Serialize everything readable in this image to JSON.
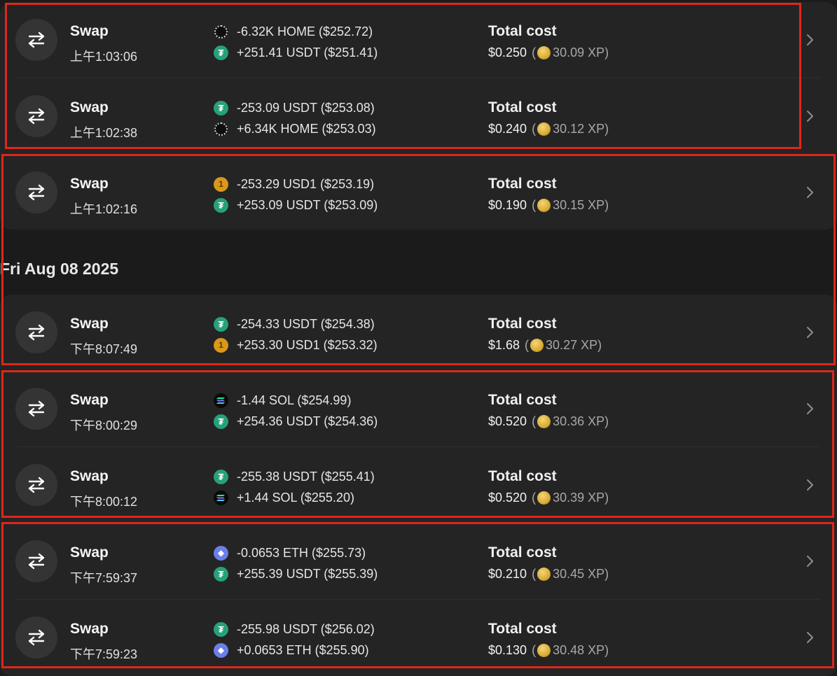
{
  "date_header": "Fri Aug 08 2025",
  "colors": {
    "background": "#1b1b1b",
    "card": "#242424",
    "highlight_box": "#e0261b",
    "usdt": "#26a17b",
    "usd1": "#d9981a",
    "eth": "#6c7fe8"
  },
  "cost_label": "Total cost",
  "transactions": [
    {
      "type": "Swap",
      "time": "上午1:03:06",
      "sent": {
        "token": "HOME",
        "icon": "home-token-icon",
        "text": "-6.32K HOME ($252.72)"
      },
      "received": {
        "token": "USDT",
        "icon": "usdt-token-icon",
        "text": "+251.41 USDT ($251.41)"
      },
      "cost": "$0.250",
      "xp": "30.09 XP"
    },
    {
      "type": "Swap",
      "time": "上午1:02:38",
      "sent": {
        "token": "USDT",
        "icon": "usdt-token-icon",
        "text": "-253.09 USDT ($253.08)"
      },
      "received": {
        "token": "HOME",
        "icon": "home-token-icon",
        "text": "+6.34K HOME ($253.03)"
      },
      "cost": "$0.240",
      "xp": "30.12 XP"
    },
    {
      "type": "Swap",
      "time": "上午1:02:16",
      "sent": {
        "token": "USD1",
        "icon": "usd1-token-icon",
        "text": "-253.29 USD1 ($253.19)"
      },
      "received": {
        "token": "USDT",
        "icon": "usdt-token-icon",
        "text": "+253.09 USDT ($253.09)"
      },
      "cost": "$0.190",
      "xp": "30.15 XP"
    },
    {
      "type": "Swap",
      "time": "下午8:07:49",
      "sent": {
        "token": "USDT",
        "icon": "usdt-token-icon",
        "text": "-254.33 USDT ($254.38)"
      },
      "received": {
        "token": "USD1",
        "icon": "usd1-token-icon",
        "text": "+253.30 USD1 ($253.32)"
      },
      "cost": "$1.68",
      "xp": "30.27 XP"
    },
    {
      "type": "Swap",
      "time": "下午8:00:29",
      "sent": {
        "token": "SOL",
        "icon": "sol-token-icon",
        "text": "-1.44 SOL ($254.99)"
      },
      "received": {
        "token": "USDT",
        "icon": "usdt-token-icon",
        "text": "+254.36 USDT ($254.36)"
      },
      "cost": "$0.520",
      "xp": "30.36 XP"
    },
    {
      "type": "Swap",
      "time": "下午8:00:12",
      "sent": {
        "token": "USDT",
        "icon": "usdt-token-icon",
        "text": "-255.38 USDT ($255.41)"
      },
      "received": {
        "token": "SOL",
        "icon": "sol-token-icon",
        "text": "+1.44 SOL ($255.20)"
      },
      "cost": "$0.520",
      "xp": "30.39 XP"
    },
    {
      "type": "Swap",
      "time": "下午7:59:37",
      "sent": {
        "token": "ETH",
        "icon": "eth-token-icon",
        "text": "-0.0653 ETH ($255.73)"
      },
      "received": {
        "token": "USDT",
        "icon": "usdt-token-icon",
        "text": "+255.39 USDT ($255.39)"
      },
      "cost": "$0.210",
      "xp": "30.45 XP"
    },
    {
      "type": "Swap",
      "time": "下午7:59:23",
      "sent": {
        "token": "USDT",
        "icon": "usdt-token-icon",
        "text": "-255.98 USDT ($256.02)"
      },
      "received": {
        "token": "ETH",
        "icon": "eth-token-icon",
        "text": "+0.0653 ETH ($255.90)"
      },
      "cost": "$0.130",
      "xp": "30.48 XP"
    }
  ]
}
